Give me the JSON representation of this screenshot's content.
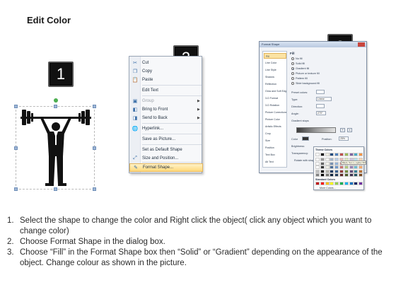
{
  "title": "Edit Color",
  "badges": [
    "1",
    "2",
    "3"
  ],
  "menu": {
    "items": [
      {
        "icon": "scissors-icon",
        "glyph": "✂",
        "label": "Cut",
        "disabled": false,
        "submenu": false
      },
      {
        "icon": "copy-icon",
        "glyph": "❐",
        "label": "Copy",
        "disabled": false,
        "submenu": false
      },
      {
        "icon": "paste-icon",
        "glyph": "📋",
        "label": "Paste",
        "disabled": false,
        "submenu": false
      },
      {
        "icon": "",
        "glyph": "",
        "label": "Edit Text",
        "disabled": false,
        "submenu": false
      },
      {
        "icon": "group-icon",
        "glyph": "▣",
        "label": "Group",
        "disabled": true,
        "submenu": true
      },
      {
        "icon": "bring-front-icon",
        "glyph": "◧",
        "label": "Bring to Front",
        "disabled": false,
        "submenu": true
      },
      {
        "icon": "send-back-icon",
        "glyph": "◨",
        "label": "Send to Back",
        "disabled": false,
        "submenu": true
      },
      {
        "icon": "hyperlink-icon",
        "glyph": "🌐",
        "label": "Hyperlink...",
        "disabled": false,
        "submenu": false
      },
      {
        "icon": "",
        "glyph": "",
        "label": "Save as Picture...",
        "disabled": false,
        "submenu": false
      },
      {
        "icon": "",
        "glyph": "",
        "label": "Set as Default Shape",
        "disabled": false,
        "submenu": false
      },
      {
        "icon": "size-position-icon",
        "glyph": "⤢",
        "label": "Size and Position...",
        "disabled": false,
        "submenu": false
      },
      {
        "icon": "format-shape-icon",
        "glyph": "✎",
        "label": "Format Shape...",
        "disabled": false,
        "submenu": false,
        "highlighted": true
      }
    ]
  },
  "dialog": {
    "title": "Format Shape",
    "sidebar": [
      "Fill",
      "Line Color",
      "Line Style",
      "Shadow",
      "Reflection",
      "Glow and Soft Edges",
      "3-D Format",
      "3-D Rotation",
      "Picture Corrections",
      "Picture Color",
      "Artistic Effects",
      "Crop",
      "Size",
      "Position",
      "Text Box",
      "Alt Text"
    ],
    "selected_sidebar": "Fill",
    "fill_heading": "Fill",
    "fill_options": [
      "No fill",
      "Solid fill",
      "Gradient fill",
      "Picture or texture fill",
      "Pattern fill",
      "Slide background fill"
    ],
    "selected_fill": "Gradient fill",
    "preset_label": "Preset colors:",
    "type_label": "Type:",
    "type_value": "Linear",
    "direction_label": "Direction:",
    "angle_label": "Angle:",
    "angle_value": "270°",
    "stops_label": "Gradient stops",
    "color_label": "Color",
    "position_label": "Position:",
    "position_value": "25%",
    "brightness_label": "Brightness:",
    "transparency_label": "Transparency:",
    "rotate_label": "Rotate with shape",
    "close_label": "Close",
    "palette_theme": "Theme Colors",
    "palette_standard": "Standard Colors",
    "palette_more": "More Colors...",
    "tooltip": "Black, Text 1, Lighter 50%"
  },
  "palette_colors": {
    "theme_row": [
      "#ffffff",
      "#000000",
      "#eeece1",
      "#1f497d",
      "#4f81bd",
      "#c0504d",
      "#9bbb59",
      "#8064a2",
      "#4bacc6",
      "#f79646"
    ],
    "standard_row": [
      "#c00000",
      "#ff0000",
      "#ffc000",
      "#ffff00",
      "#92d050",
      "#00b050",
      "#00b0f0",
      "#0070c0",
      "#002060",
      "#7030a0"
    ]
  },
  "steps": [
    {
      "num": "1.",
      "text": "Select the shape to change the color and Right click the object( click any object which you want to change color)"
    },
    {
      "num": "2.",
      "text": "Choose Format Shape in the dialog box."
    },
    {
      "num": "3.",
      "text": "Choose “Fill” in the Format Shape box then “Solid” or “Gradient” depending on the appearance of the object. Change colour as shown in the picture."
    }
  ]
}
